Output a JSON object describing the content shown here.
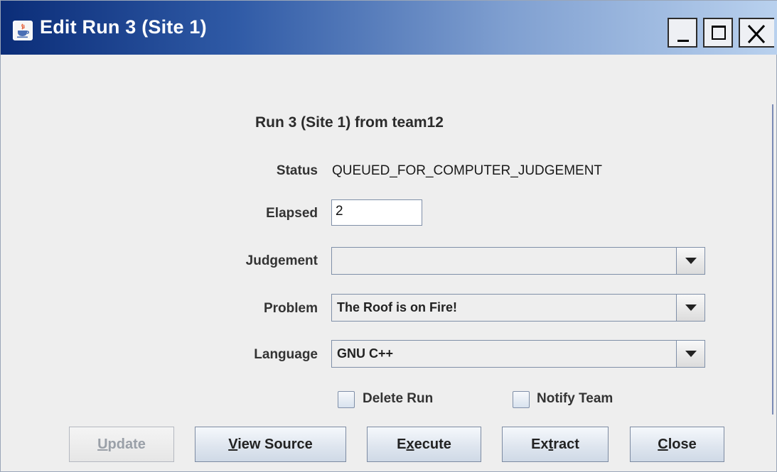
{
  "window": {
    "title": "Edit Run 3 (Site 1)",
    "icon": "java-cup-icon",
    "controls": [
      "minimize-icon",
      "maximize-icon",
      "close-icon"
    ]
  },
  "form": {
    "heading": "Run 3 (Site 1) from team12",
    "status_label": "Status",
    "status_value": "QUEUED_FOR_COMPUTER_JUDGEMENT",
    "elapsed_label": "Elapsed",
    "elapsed_value": "2",
    "judgement_label": "Judgement",
    "judgement_value": "",
    "problem_label": "Problem",
    "problem_value": "The Roof is on Fire!",
    "language_label": "Language",
    "language_value": "GNU C++",
    "delete_run_label": "Delete Run",
    "delete_run_checked": false,
    "notify_team_label": "Notify Team",
    "notify_team_checked": false
  },
  "buttons": {
    "update": {
      "mnemonic": "U",
      "rest": "pdate",
      "enabled": false
    },
    "view_source": {
      "mnemonic": "V",
      "rest": "iew Source",
      "enabled": true
    },
    "execute": {
      "pre": "E",
      "mnemonic": "x",
      "rest": "ecute",
      "enabled": true
    },
    "extract": {
      "pre": "Ex",
      "mnemonic": "t",
      "rest": "ract",
      "enabled": true
    },
    "close": {
      "mnemonic": "C",
      "rest": "lose",
      "enabled": true
    }
  },
  "colors": {
    "titlebar_start": "#0b2d78",
    "titlebar_end": "#b9d1ee",
    "background": "#eeeeee"
  }
}
